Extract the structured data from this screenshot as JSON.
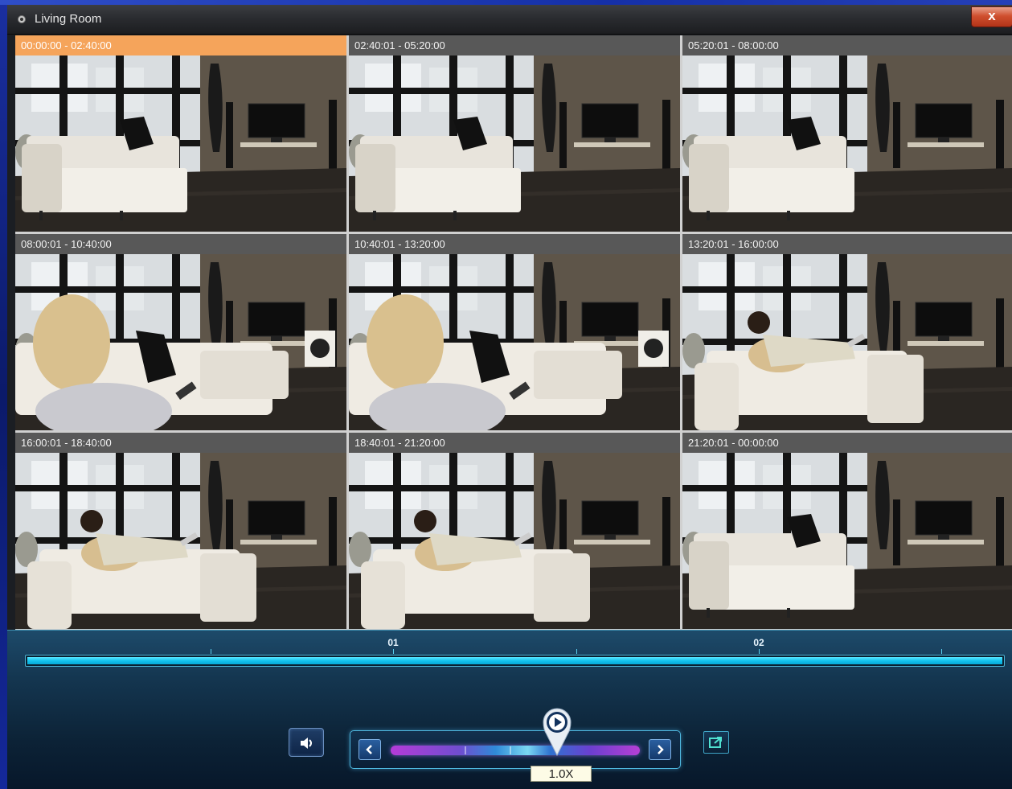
{
  "window": {
    "title": "Living Room",
    "close_label": "x"
  },
  "colors": {
    "selected_header": "#f5a45b",
    "header": "#585858",
    "timeline": "#14c4ef",
    "speed_track": "#b53bd8"
  },
  "thumbnails": [
    {
      "range": "00:00:00 - 02:40:00",
      "scene": "empty-sofa",
      "selected": true
    },
    {
      "range": "02:40:01 - 05:20:00",
      "scene": "empty-sofa",
      "selected": false
    },
    {
      "range": "05:20:01 - 08:00:00",
      "scene": "empty-sofa",
      "selected": false
    },
    {
      "range": "08:00:01 - 10:40:00",
      "scene": "woman-on-sofa",
      "selected": false
    },
    {
      "range": "10:40:01 - 13:20:00",
      "scene": "woman-on-sofa",
      "selected": false
    },
    {
      "range": "13:20:01 - 16:00:00",
      "scene": "couple-on-sofa",
      "selected": false
    },
    {
      "range": "16:00:01 - 18:40:00",
      "scene": "couple-on-sofa",
      "selected": false
    },
    {
      "range": "18:40:01 - 21:20:00",
      "scene": "couple-on-sofa",
      "selected": false
    },
    {
      "range": "21:20:01 - 00:00:00",
      "scene": "empty-sofa",
      "selected": false
    }
  ],
  "timeline": {
    "labels": [
      "01",
      "02"
    ]
  },
  "playback": {
    "speed_label": "1.0X",
    "speed_fraction": 0.67,
    "sound_icon": "speaker-icon",
    "play_icon": "play-icon",
    "prev_icon": "chevron-left-icon",
    "next_icon": "chevron-right-icon",
    "export_icon": "export-icon"
  }
}
